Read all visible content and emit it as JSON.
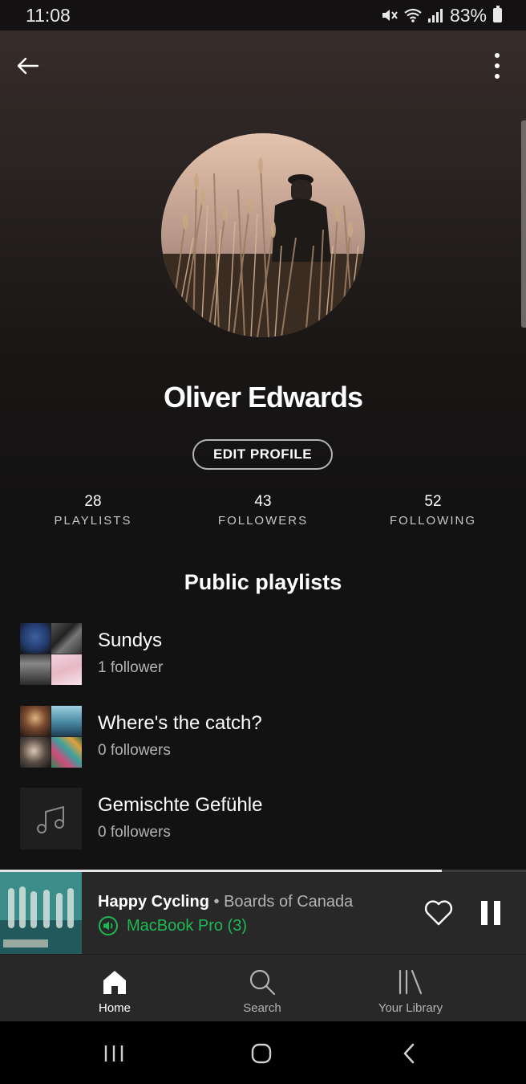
{
  "status_bar": {
    "time": "11:08",
    "battery": "83%"
  },
  "profile": {
    "name": "Oliver Edwards",
    "edit_label": "EDIT PROFILE",
    "stats": [
      {
        "value": "28",
        "label": "PLAYLISTS"
      },
      {
        "value": "43",
        "label": "FOLLOWERS"
      },
      {
        "value": "52",
        "label": "FOLLOWING"
      }
    ]
  },
  "section": {
    "title": "Public playlists"
  },
  "playlists": [
    {
      "name": "Sundys",
      "followers": "1 follower"
    },
    {
      "name": "Where's the catch?",
      "followers": "0 followers"
    },
    {
      "name": "Gemischte Gefühle",
      "followers": "0 followers"
    }
  ],
  "now_playing": {
    "title": "Happy Cycling",
    "separator": "•",
    "artist": "Boards of Canada",
    "device": "MacBook Pro (3)",
    "progress": 0.84
  },
  "nav": {
    "items": [
      {
        "label": "Home",
        "icon": "home-icon",
        "active": true
      },
      {
        "label": "Search",
        "icon": "search-icon",
        "active": false
      },
      {
        "label": "Your Library",
        "icon": "library-icon",
        "active": false
      }
    ]
  },
  "colors": {
    "accent": "#1db954",
    "background": "#121212",
    "player_bg": "#282828"
  }
}
